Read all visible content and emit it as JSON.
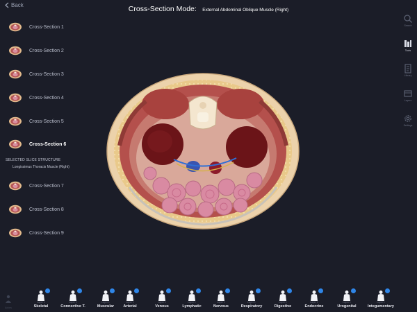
{
  "header": {
    "back_label": "Back",
    "title": "Cross-Section Mode:",
    "subtitle": "External Abdominal Oblique Muscle (Right)"
  },
  "sections": [
    {
      "label": "Cross-Section 1"
    },
    {
      "label": "Cross-Section 2"
    },
    {
      "label": "Cross-Section 3"
    },
    {
      "label": "Cross-Section 4"
    },
    {
      "label": "Cross-Section 5"
    },
    {
      "label": "Cross-Section 6",
      "active": true
    },
    {
      "label": "Cross-Section 7"
    },
    {
      "label": "Cross-Section 8"
    },
    {
      "label": "Cross-Section 9"
    }
  ],
  "selected_slice": {
    "heading": "SELECTED SLICE STRUCTURE",
    "value": "Longissimus Thoracis Muscle (Right)"
  },
  "right_tools": [
    {
      "label": "Search",
      "icon": "search-icon"
    },
    {
      "label": "Tools",
      "icon": "tools-icon",
      "active": true
    },
    {
      "label": "Library",
      "icon": "library-icon"
    },
    {
      "label": "Layers",
      "icon": "layers-icon"
    },
    {
      "label": "Settings",
      "icon": "gear-icon"
    }
  ],
  "systems_bar": {
    "actors_label": "Actors",
    "items": [
      {
        "layer": "Layer 1",
        "label": "Skeletal"
      },
      {
        "layer": "Layer 1",
        "label": "Connective T."
      },
      {
        "layer": "Layer 1",
        "label": "Muscular"
      },
      {
        "layer": "Layer 1",
        "label": "Arterial"
      },
      {
        "layer": "Layer 1",
        "label": "Venous"
      },
      {
        "layer": "Layer 1",
        "label": "Lymphatic"
      },
      {
        "layer": "Layer 1",
        "label": "Nervous"
      },
      {
        "layer": "Layer 1",
        "label": "Respiratory"
      },
      {
        "layer": "Layer 1",
        "label": "Digestive"
      },
      {
        "layer": "Layer 1",
        "label": "Endocrine"
      },
      {
        "layer": "Layer 1",
        "label": "Urogenital"
      },
      {
        "layer": "Layer 1",
        "label": "Integumentary"
      }
    ]
  },
  "colors": {
    "background": "#1b1d28",
    "badge": "#2f86e8",
    "skin": "#e8c9a0",
    "muscle": "#b04848",
    "organ": "#7a1c22",
    "intestine": "#d58aa0"
  }
}
